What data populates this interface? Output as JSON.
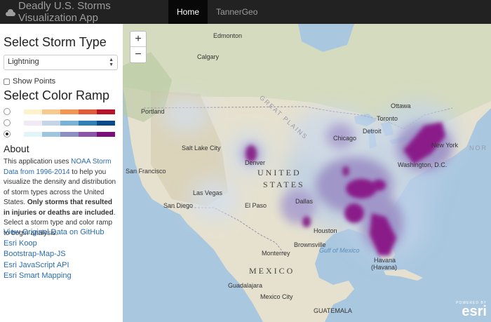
{
  "navbar": {
    "brand": "Deadly U.S. Storms Visualization App",
    "brand_icon": "cloud-icon",
    "items": [
      {
        "label": "Home",
        "active": true
      },
      {
        "label": "TannerGeo",
        "active": false
      }
    ]
  },
  "sidebar": {
    "storm_type_heading": "Select Storm Type",
    "storm_type_value": "Lightning",
    "show_points_label": "Show Points",
    "show_points_checked": false,
    "color_ramp_heading": "Select Color Ramp",
    "ramps": [
      {
        "colors": [
          "#fdf2cc",
          "#f8c98f",
          "#f29656",
          "#e15a3a",
          "#b5142a"
        ],
        "selected": false
      },
      {
        "colors": [
          "#f0eaf4",
          "#c5d5e8",
          "#7ab1d6",
          "#2f7fb6",
          "#0a4a8a"
        ],
        "selected": false
      },
      {
        "colors": [
          "#e3f4f8",
          "#9fc4de",
          "#8c8fc2",
          "#8c56a8",
          "#7a0f7a"
        ],
        "selected": true
      }
    ],
    "about_heading": "About",
    "about": {
      "p1": "This application uses ",
      "link": "NOAA Storm Data from 1996-2014",
      "p2": " to help you visualize the density and distribution of storm types across the United States. ",
      "bold": "Only storms that resulted in injuries or deaths are included",
      "p3": ". Select a storm type and color ramp to begin analysis."
    },
    "links": [
      "View Original Data on GitHub",
      "Esri Koop",
      "Bootstrap-Map-JS",
      "Esri JavaScript API",
      "Esri Smart Mapping"
    ]
  },
  "map": {
    "zoom_in": "+",
    "zoom_out": "−",
    "labels": {
      "edmonton": "Edmonton",
      "calgary": "Calgary",
      "portland": "Portland",
      "salt_lake_city": "Salt Lake City",
      "denver": "Denver",
      "san_francisco": "San Francisco",
      "las_vegas": "Las Vegas",
      "san_diego": "San Diego",
      "el_paso": "El Paso",
      "ottawa": "Ottawa",
      "toronto": "Toronto",
      "detroit": "Detroit",
      "chicago": "Chicago",
      "washington": "Washington, D.C.",
      "new_york": "New York",
      "dallas": "Dallas",
      "houston": "Houston",
      "brownsville": "Brownsville",
      "monterrey": "Monterrey",
      "havana": "Havana",
      "habana": "(Havana)",
      "guadalajara": "Guadalajara",
      "mexico_city": "Mexico City",
      "guatemala": "GUATEMALA",
      "united": "UNITED",
      "states": "STATES",
      "mexico": "MEXICO",
      "gulf": "Gulf of Mexico",
      "great_plains": "GREAT PLAINS",
      "nor": "NOR"
    },
    "powered_by": "POWERED BY",
    "esri_logo": "esri"
  }
}
